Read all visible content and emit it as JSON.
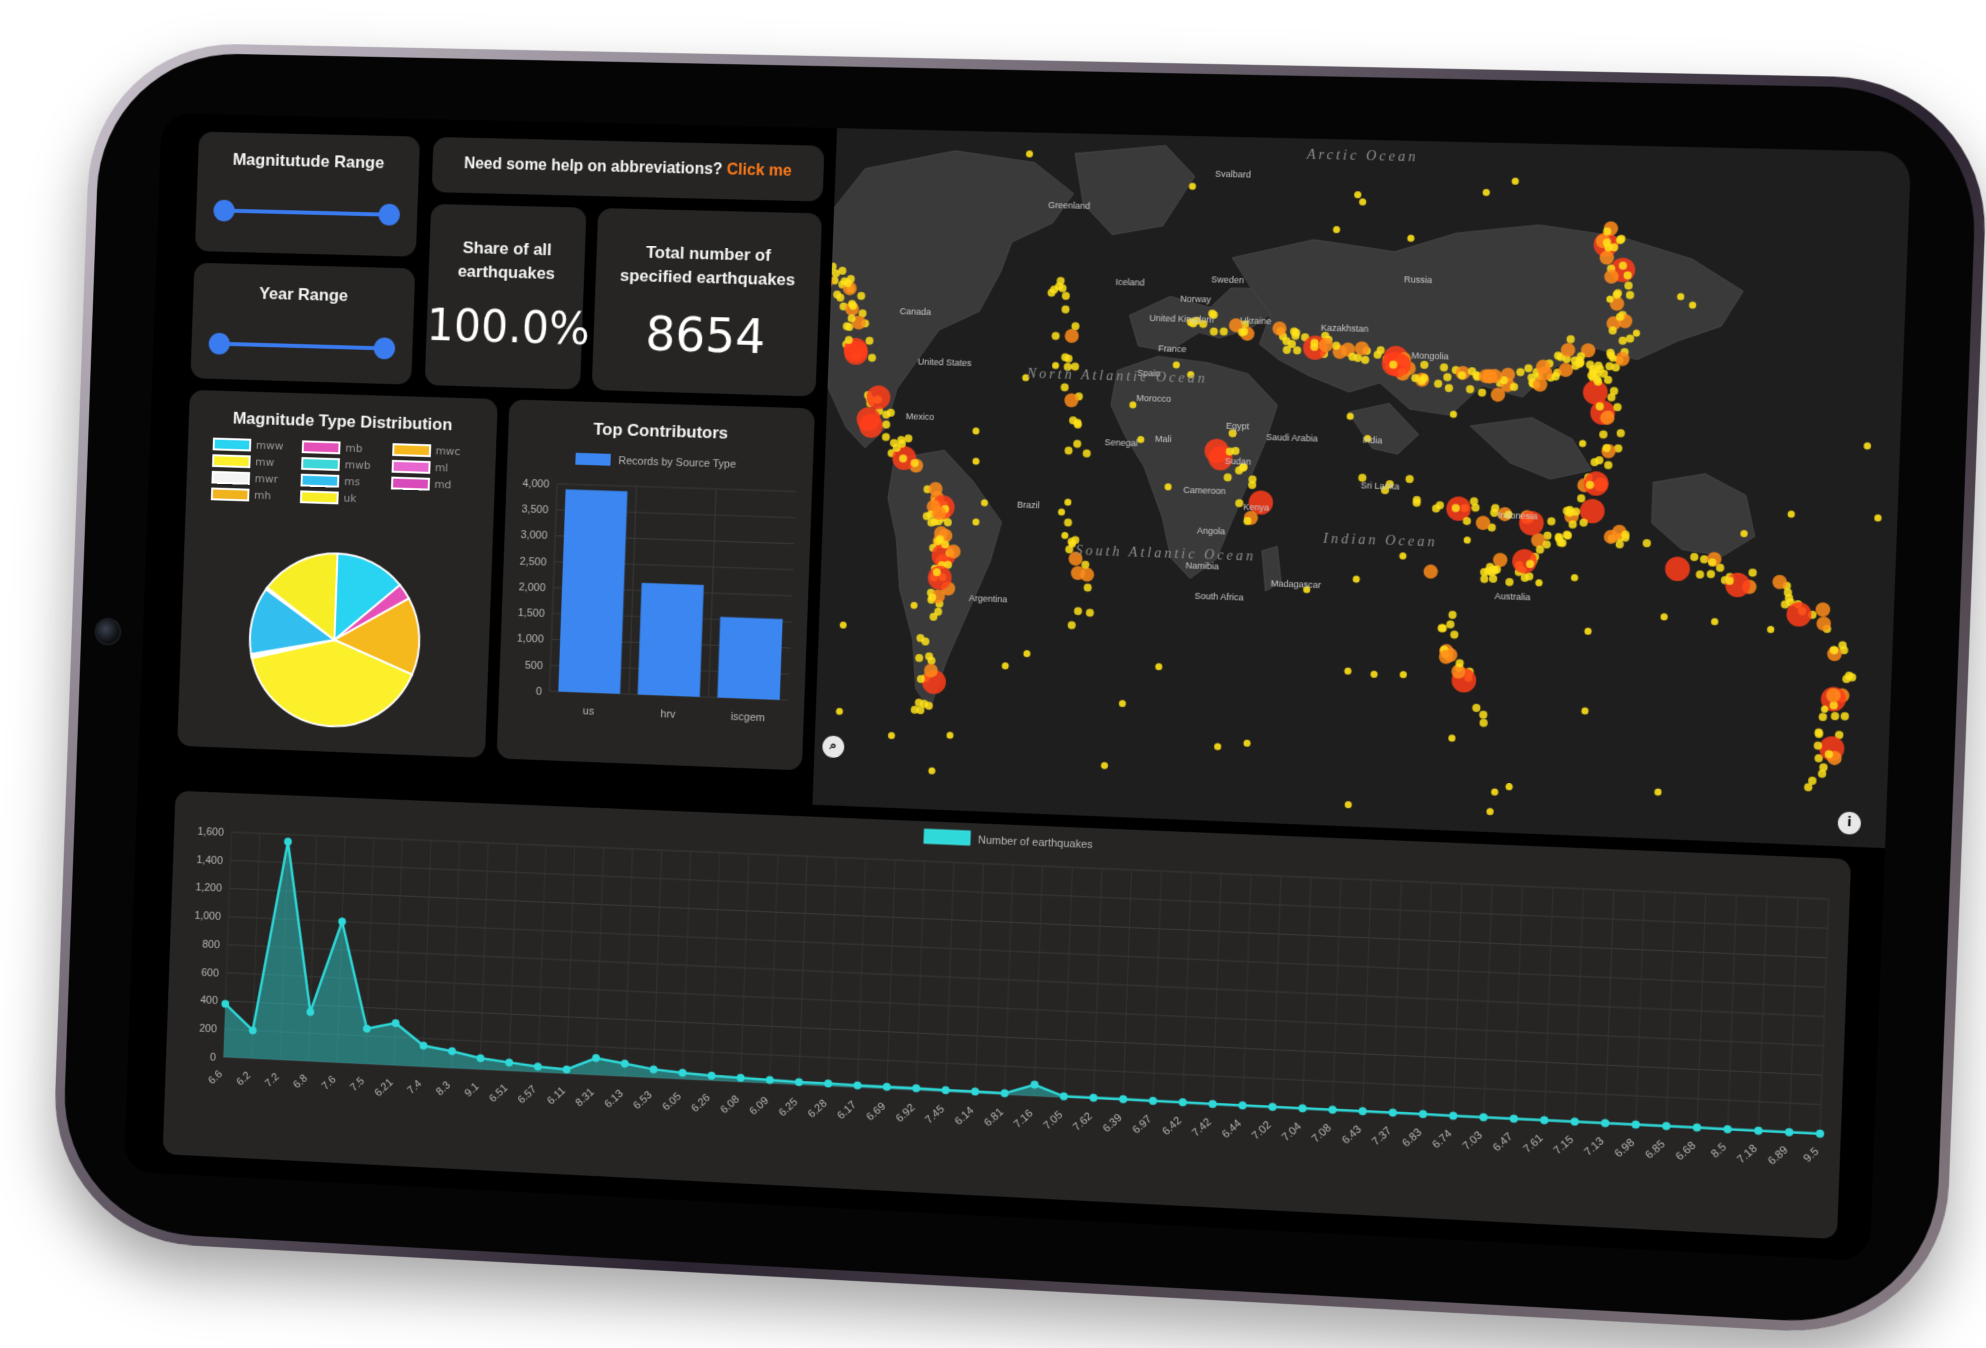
{
  "filters": {
    "magnitude_range": {
      "title": "Magnitutude Range",
      "low": 0.0,
      "high": 1.0
    },
    "year_range": {
      "title": "Year Range",
      "low": 0.0,
      "high": 1.0
    }
  },
  "help": {
    "text": "Need some help on abbreviations?",
    "link": "Click me"
  },
  "kpis": {
    "share": {
      "title": "Share of all earthquakes",
      "value": "100.0%"
    },
    "total": {
      "title": "Total number of specified earthquakes",
      "value": "8654"
    }
  },
  "magnitude_types": {
    "title": "Magnitude Type Distribution",
    "legend": [
      {
        "label": "mww",
        "color": "#29d3f2"
      },
      {
        "label": "mb",
        "color": "#e54fb8"
      },
      {
        "label": "mwc",
        "color": "#f5b81d"
      },
      {
        "label": "mw",
        "color": "#fbf029"
      },
      {
        "label": "mwb",
        "color": "#3dd6d9"
      },
      {
        "label": "ml",
        "color": "#e866d0"
      },
      {
        "label": "mwr",
        "color": "#f4f4f4"
      },
      {
        "label": "ms",
        "color": "#32bff0"
      },
      {
        "label": "md",
        "color": "#d94bbb"
      },
      {
        "label": "mh",
        "color": "#f0b21d"
      },
      {
        "label": "uk",
        "color": "#f8ee26"
      }
    ]
  },
  "top_contributors": {
    "title": "Top Contributors"
  },
  "map": {
    "labels": [
      {
        "text": "Greenland",
        "key": "greenland"
      },
      {
        "text": "Canada",
        "key": "canada"
      },
      {
        "text": "United States",
        "key": "usa"
      },
      {
        "text": "Mexico",
        "key": "mexico"
      },
      {
        "text": "Brazil",
        "key": "brazil"
      },
      {
        "text": "Argentina",
        "key": "argentina"
      },
      {
        "text": "Iceland",
        "key": "iceland"
      },
      {
        "text": "Svalbard",
        "key": "svalbard"
      },
      {
        "text": "Sweden",
        "key": "sweden"
      },
      {
        "text": "Norway",
        "key": "norway"
      },
      {
        "text": "United Kingdom",
        "key": "uk"
      },
      {
        "text": "France",
        "key": "france"
      },
      {
        "text": "Spain",
        "key": "spain"
      },
      {
        "text": "Morocco",
        "key": "morocco"
      },
      {
        "text": "Mali",
        "key": "mali"
      },
      {
        "text": "Senegal",
        "key": "senegal"
      },
      {
        "text": "Egypt",
        "key": "egypt"
      },
      {
        "text": "Saudi Arabia",
        "key": "saudi"
      },
      {
        "text": "Sudan",
        "key": "sudan"
      },
      {
        "text": "Cameroon",
        "key": "cameroon"
      },
      {
        "text": "Kenya",
        "key": "kenya"
      },
      {
        "text": "Angola",
        "key": "angola"
      },
      {
        "text": "Namibia",
        "key": "namibia"
      },
      {
        "text": "South Africa",
        "key": "southafrica"
      },
      {
        "text": "Madagascar",
        "key": "madagascar"
      },
      {
        "text": "Ukraine",
        "key": "ukraine"
      },
      {
        "text": "Kazakhstan",
        "key": "kazakhstan"
      },
      {
        "text": "Russia",
        "key": "russia"
      },
      {
        "text": "Mongolia",
        "key": "mongolia"
      },
      {
        "text": "India",
        "key": "india"
      },
      {
        "text": "Sri Lanka",
        "key": "srilanka"
      },
      {
        "text": "Indonesia",
        "key": "indonesia"
      },
      {
        "text": "Australia",
        "key": "australia"
      }
    ],
    "oceans": [
      {
        "text": "Arctic Ocean",
        "key": "arctic"
      },
      {
        "text": "North Atlantic Ocean",
        "key": "northatlantic"
      },
      {
        "text": "South Atlantic Ocean",
        "key": "southatlantic"
      },
      {
        "text": "Indian Ocean",
        "key": "indian"
      }
    ],
    "colors": {
      "land": "#3a3a3a",
      "water": "#1e1e1e",
      "small": "#ffe21a",
      "medium": "#ff8c1a",
      "large": "#ff3d1a"
    }
  },
  "chart_data": [
    {
      "type": "pie",
      "title": "Magnitude Type Distribution",
      "categories": [
        "mww",
        "mb",
        "mwc",
        "mw",
        "mwb",
        "ml",
        "mwr",
        "ms",
        "md",
        "mh",
        "uk"
      ],
      "values": [
        13.5,
        3.0,
        14.5,
        40.0,
        0.3,
        0.2,
        0.3,
        12.6,
        0.2,
        0.2,
        15.2
      ],
      "colors": [
        "#29d3f2",
        "#e54fb8",
        "#f5b81d",
        "#fbf029",
        "#3dd6d9",
        "#e866d0",
        "#f4f4f4",
        "#32bff0",
        "#d94bbb",
        "#f0b21d",
        "#f8ee26"
      ]
    },
    {
      "type": "bar",
      "title": "Top Contributors",
      "categories": [
        "us",
        "hrv",
        "iscgem"
      ],
      "series": [
        {
          "name": "Records by Source Type",
          "values": [
            3900,
            2150,
            1550
          ]
        }
      ],
      "ylim": [
        0,
        4000
      ],
      "yticks": [
        "0",
        "500",
        "1,000",
        "1,500",
        "2,000",
        "2,500",
        "3,000",
        "3,500",
        "4,000"
      ],
      "color": "#3b86f0"
    },
    {
      "type": "area",
      "categories": [
        "6.6",
        "6.2",
        "7.2",
        "6.8",
        "7.6",
        "7.5",
        "6.21",
        "7.4",
        "8.3",
        "9.1",
        "6.51",
        "6.57",
        "6.11",
        "8.31",
        "6.13",
        "6.53",
        "6.05",
        "6.26",
        "6.08",
        "6.09",
        "6.25",
        "6.28",
        "6.17",
        "6.69",
        "6.92",
        "7.45",
        "6.14",
        "6.81",
        "7.16",
        "7.05",
        "7.62",
        "6.39",
        "6.97",
        "6.42",
        "7.42",
        "6.44",
        "7.02",
        "7.04",
        "7.08",
        "6.43",
        "7.37",
        "6.83",
        "6.74",
        "7.03",
        "6.47",
        "7.61",
        "7.15",
        "7.13",
        "6.98",
        "6.85",
        "6.68",
        "8.5",
        "7.18",
        "6.89",
        "9.5"
      ],
      "series": [
        {
          "name": "Number of earthquakes",
          "values": [
            380,
            200,
            1550,
            350,
            1000,
            250,
            300,
            150,
            120,
            80,
            60,
            40,
            30,
            120,
            90,
            60,
            45,
            35,
            30,
            25,
            20,
            20,
            15,
            15,
            15,
            12,
            12,
            10,
            80,
            8,
            8,
            8,
            7,
            7,
            6,
            6,
            6,
            5,
            5,
            5,
            5,
            5,
            4,
            4,
            4,
            4,
            3,
            3,
            3,
            3,
            3,
            2,
            2,
            2,
            1
          ]
        }
      ],
      "ylim": [
        0,
        1600
      ],
      "yticks": [
        "0",
        "200",
        "400",
        "600",
        "800",
        "1,000",
        "1,200",
        "1,400",
        "1,600"
      ],
      "color": "#2fd9d9"
    }
  ]
}
